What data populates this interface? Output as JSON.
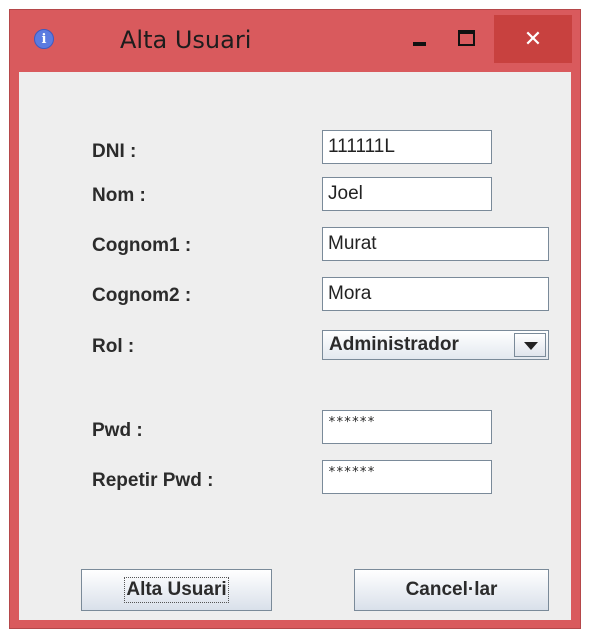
{
  "window": {
    "title": "Alta Usuari",
    "close_symbol": "✕",
    "info_symbol": "i"
  },
  "form": {
    "dni": {
      "label": "DNI :",
      "value": "111111L"
    },
    "nom": {
      "label": "Nom :",
      "value": "Joel"
    },
    "cognom1": {
      "label": "Cognom1 :",
      "value": "Murat"
    },
    "cognom2": {
      "label": "Cognom2 :",
      "value": "Mora"
    },
    "rol": {
      "label": "Rol :",
      "selected": "Administrador"
    },
    "pwd": {
      "label": "Pwd :",
      "value": "******"
    },
    "repetir_pwd": {
      "label": "Repetir Pwd :",
      "value": "******"
    }
  },
  "buttons": {
    "alta": "Alta Usuari",
    "cancel": "Cancel·lar"
  },
  "colors": {
    "title_bar": "#d95a5d",
    "close_button": "#c8413f",
    "content_bg": "#eeeeee"
  },
  "icons": {
    "title": "info-icon",
    "minimize": "minimize-icon",
    "maximize": "maximize-icon",
    "close": "close-icon",
    "dropdown": "chevron-down-icon"
  }
}
